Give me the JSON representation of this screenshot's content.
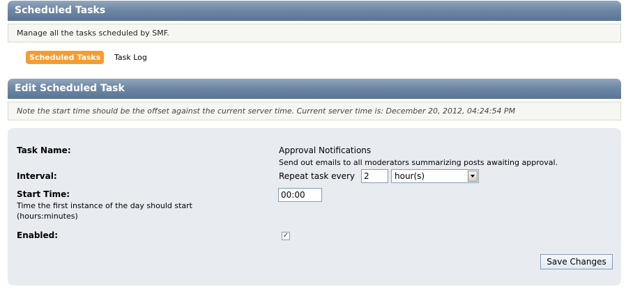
{
  "header": {
    "title": "Scheduled Tasks"
  },
  "intro": {
    "text": "Manage all the tasks scheduled by SMF."
  },
  "tabs": [
    {
      "label": "Scheduled Tasks",
      "active": true
    },
    {
      "label": "Task Log",
      "active": false
    }
  ],
  "edit": {
    "title": "Edit Scheduled Task",
    "note": "Note the start time should be the offset against the current server time. Current server time is: December 20, 2012, 04:24:54 PM"
  },
  "form": {
    "task_name_label": "Task Name:",
    "task_name_value": "Approval Notifications",
    "task_description": "Send out emails to all moderators summarizing posts awaiting approval.",
    "interval_label": "Interval:",
    "interval_prefix": "Repeat task every",
    "interval_value": "2",
    "interval_unit": "hour(s)",
    "start_time_label": "Start Time:",
    "start_time_help": "Time the first instance of the day should start (hours:minutes)",
    "start_time_value": "00:00",
    "enabled_label": "Enabled:",
    "enabled_checked": true,
    "save_label": "Save Changes"
  }
}
